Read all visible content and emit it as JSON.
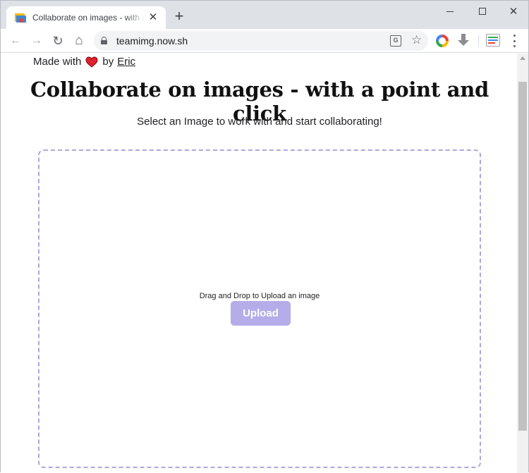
{
  "browser": {
    "tab": {
      "title": "Collaborate on images - with a point and click",
      "close": "✕"
    },
    "new_tab": "+",
    "window_controls": {
      "close": "✕"
    },
    "toolbar": {
      "back": "←",
      "forward": "→",
      "reload": "↻",
      "home": "⌂",
      "url": "teamimg.now.sh",
      "translate": "G",
      "star": "☆"
    }
  },
  "page": {
    "made_with": {
      "prefix": "Made with",
      "icon": "heart-icon",
      "by": "by",
      "author": "Eric"
    },
    "title": "Collaborate on images - with a point and click",
    "subtitle": "Select an Image to work with and start collaborating!",
    "dropzone": {
      "label": "Drag and Drop to Upload an image",
      "button": "Upload"
    }
  },
  "colors": {
    "accent": "#b5adea",
    "dropzone_border": "#b0a6e0",
    "heart": "#e0202e"
  }
}
